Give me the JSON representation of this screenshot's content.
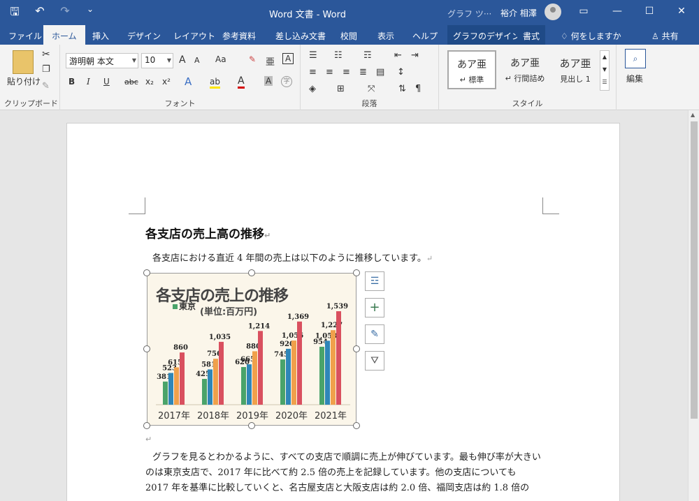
{
  "titlebar": {
    "title": "Word 文書  -  Word",
    "context_tools": "グラフ ツ···",
    "user": "裕介 相澤",
    "qat": [
      {
        "icon": "save-icon",
        "glyph": "🖫"
      },
      {
        "icon": "undo-icon",
        "glyph": "↶"
      },
      {
        "icon": "redo-icon",
        "glyph": "↷"
      },
      {
        "icon": "customize-icon",
        "glyph": "⌄"
      }
    ],
    "window": {
      "restore": "▭",
      "minimize": "—",
      "maximize": "☐",
      "close": "✕"
    }
  },
  "tabs": [
    "ファイル",
    "ホーム",
    "挿入",
    "デザイン",
    "レイアウト",
    "参考資料",
    "差し込み文書",
    "校閲",
    "表示",
    "ヘルプ",
    "グラフのデザイン",
    "書式",
    "何をしますか",
    "共有"
  ],
  "ribbon": {
    "clipboard": {
      "label": "クリップボード",
      "paste": "貼り付け"
    },
    "font": {
      "label": "フォント",
      "name": "游明朝 本文",
      "size": "10",
      "bold": "B",
      "italic": "I",
      "underline": "U",
      "strike": "abc",
      "sub": "x₂",
      "sup": "x²",
      "grow": "A",
      "shrink": "A",
      "case": "Aa",
      "clear": "✎",
      "phonetic": "亜",
      "border": "A",
      "effects": "A",
      "highlight": "ab",
      "color": "A",
      "shade": "A",
      "enclose": "字"
    },
    "paragraph": {
      "label": "段落"
    },
    "styles": {
      "label": "スタイル",
      "items": [
        {
          "sample": "あア亜",
          "name": "↵ 標準"
        },
        {
          "sample": "あア亜",
          "name": "↵ 行間詰め"
        },
        {
          "sample": "あア亜",
          "name": "見出し 1"
        }
      ]
    },
    "editing": {
      "label": "編集"
    }
  },
  "document": {
    "heading": "各支店の売上高の推移",
    "intro": "各支店における直近 4 年間の売上は以下のように推移しています。",
    "empty_mark": "↵",
    "body": [
      "グラフを見るとわかるように、すべての支店で順調に売上が伸びています。最も伸び率が大きい",
      "のは東京支店で、2017 年に比べて約 2.5 倍の売上を記録しています。他の支店についても",
      "2017 年を基準に比較していくと、名古屋支店と大阪支店は約 2.0 倍、福岡支店は約 1.8 倍の"
    ],
    "para_mark": "↵"
  },
  "chart_data": {
    "type": "bar",
    "title": "各支店の売上の推移",
    "subtitle": "(単位:百万円)",
    "legend": [
      {
        "name": "東京",
        "color": "#4aa36a"
      }
    ],
    "categories": [
      "2017年",
      "2018年",
      "2019年",
      "2020年",
      "2021年"
    ],
    "series": [
      {
        "name": "東京",
        "color": "#4aa36a",
        "values": [
          381,
          425,
          620,
          745,
          954
        ]
      },
      {
        "color": "#2f86b8",
        "values": [
          523,
          581,
          665,
          920,
          1053
        ]
      },
      {
        "color": "#f0a04b",
        "values": [
          615,
          756,
          880,
          1056,
          1227
        ]
      },
      {
        "color": "#d9505f",
        "values": [
          860,
          1035,
          1214,
          1369,
          1539
        ]
      }
    ],
    "ylim": [
      0,
      1700
    ],
    "grid": false,
    "legend_position": "top-left"
  },
  "colors": {
    "brand": "#2b579a",
    "ribbon": "#f3f3f3"
  }
}
